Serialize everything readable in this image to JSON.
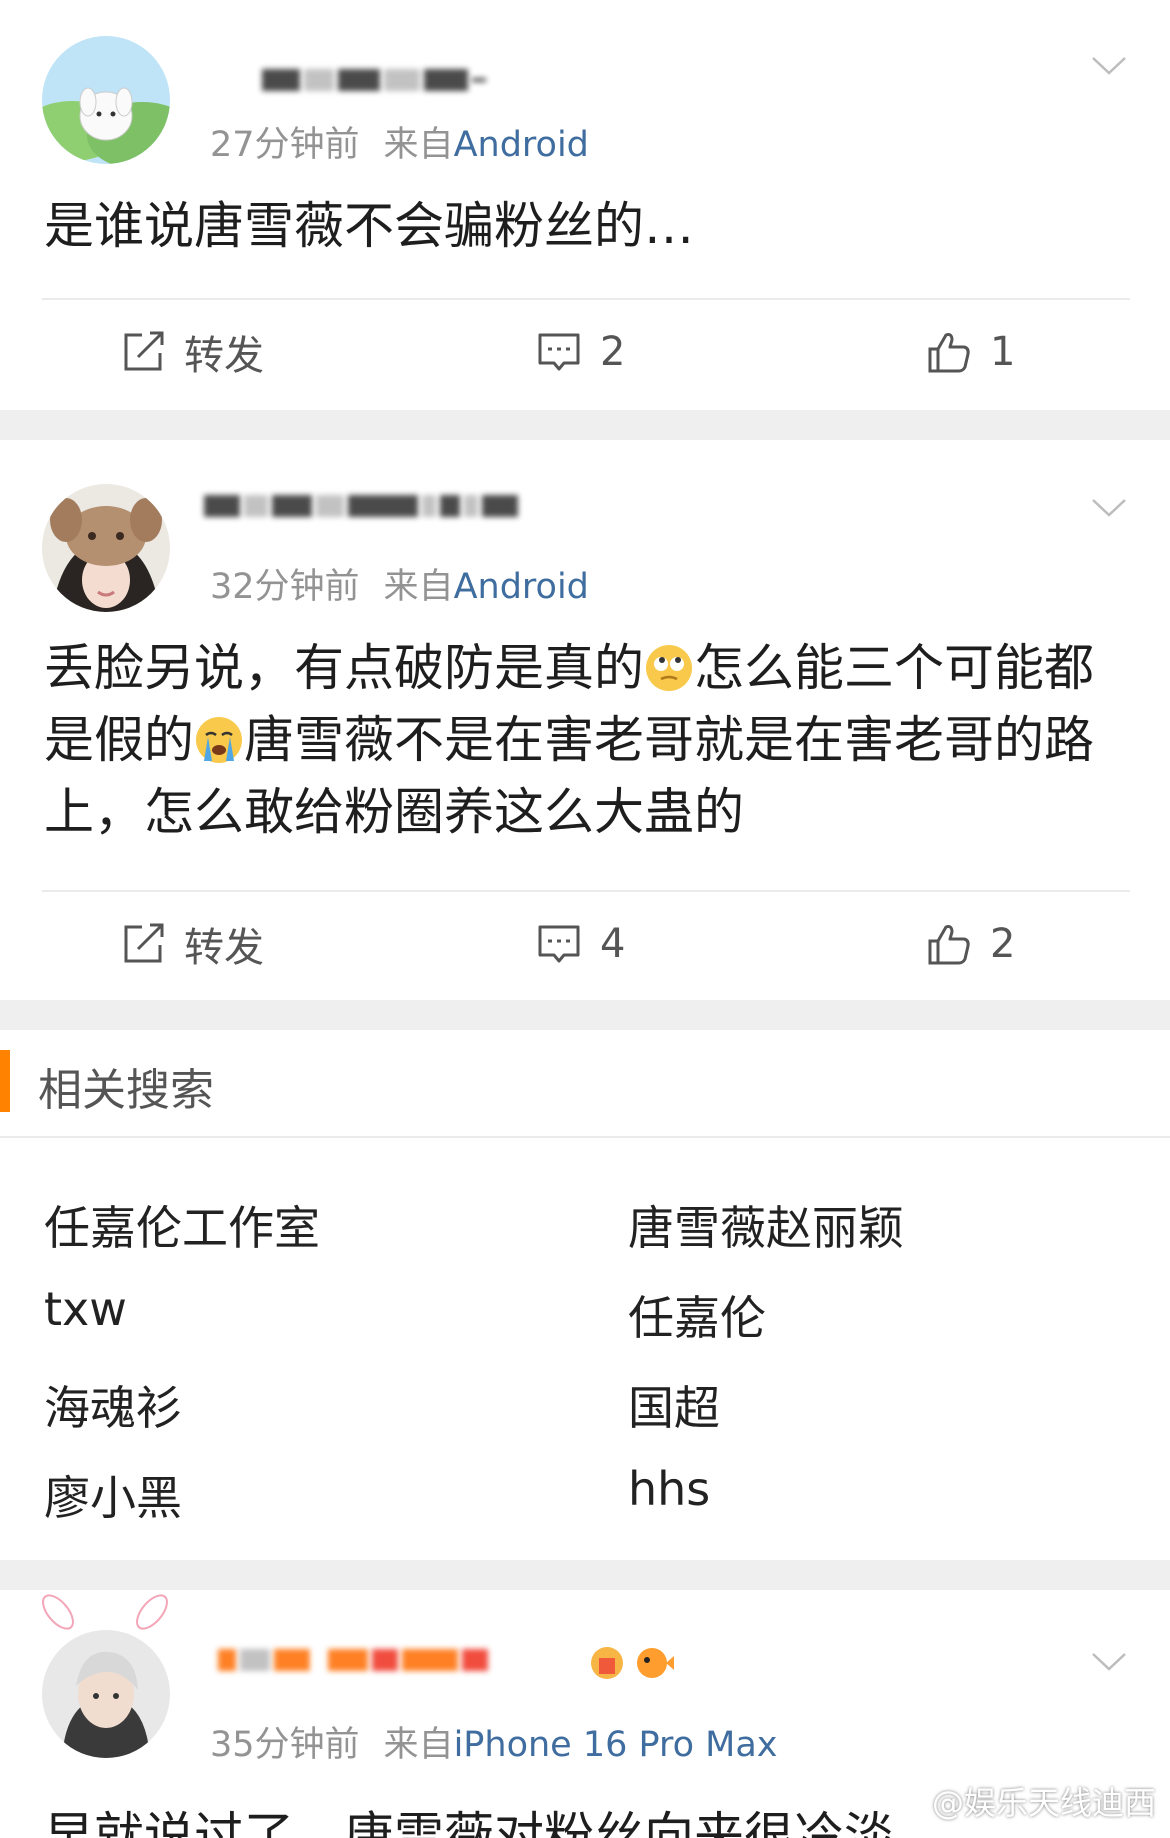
{
  "posts": [
    {
      "time": "27分钟前",
      "from_prefix": "来自",
      "source": "Android",
      "text": "是谁说唐雪薇不会骗粉丝的…",
      "repost_label": "转发",
      "comments": "2",
      "likes": "1"
    },
    {
      "time": "32分钟前",
      "from_prefix": "来自",
      "source": "Android",
      "text_1": "丢脸另说，有点破防是真的",
      "text_2": "怎么能三个可能都是假的",
      "text_3": "唐雪薇不是在害老哥就是在害老哥的路上，怎么敢给粉圈养这么大蛊的",
      "repost_label": "转发",
      "comments": "4",
      "likes": "2"
    },
    {
      "time": "35分钟前",
      "from_prefix": "来自",
      "source": "iPhone 16 Pro Max",
      "text": "早就说过了，唐雪薇对粉丝向来很冷淡"
    }
  ],
  "related": {
    "title": "相关搜索",
    "left": [
      "任嘉伦工作室",
      "txw",
      "海魂衫",
      "廖小黑"
    ],
    "right": [
      "唐雪薇赵丽颖",
      "任嘉伦",
      "国超",
      "hhs"
    ]
  },
  "watermark": "@娱乐天线迪西",
  "icons": {
    "repost": "repost-icon",
    "comment": "comment-icon",
    "like": "thumbs-up-icon",
    "chevron": "chevron-down-icon"
  },
  "colors": {
    "source_link": "#3f6d9f",
    "accent": "#ff8200",
    "meta": "#939393",
    "separator": "#efefef"
  }
}
